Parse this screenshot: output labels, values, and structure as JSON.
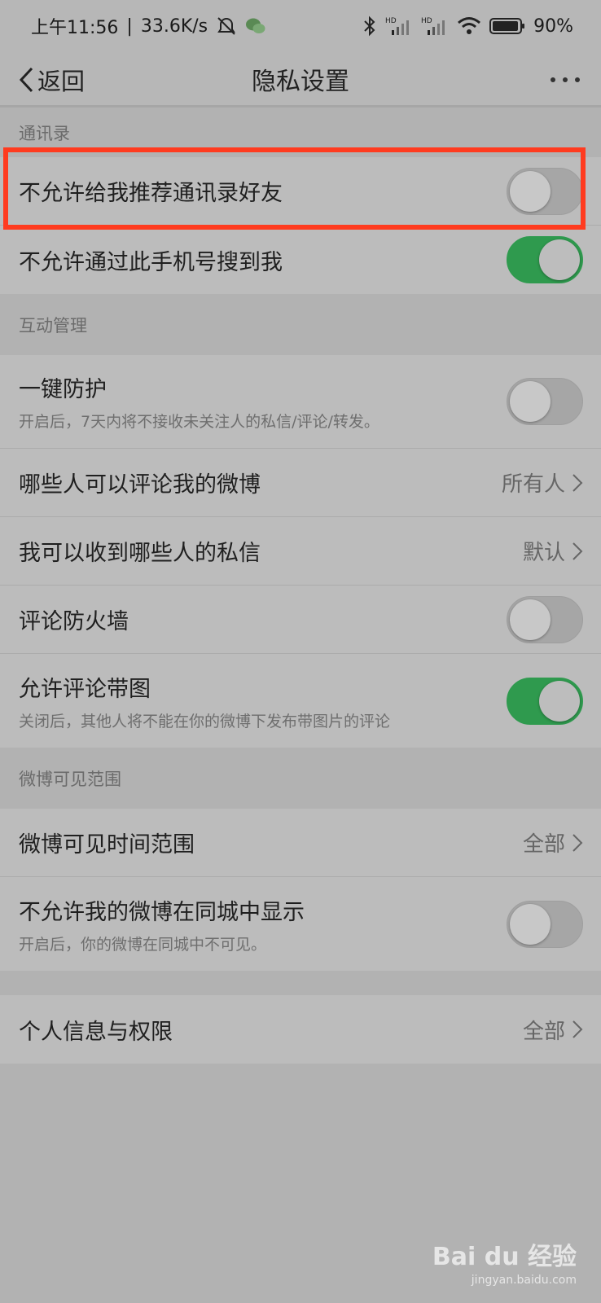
{
  "status_bar": {
    "time": "上午11:56",
    "speed": "33.6K/s",
    "battery": "90%",
    "icons": [
      "alarm-off-icon",
      "wechat-icon",
      "bluetooth-icon",
      "signal-hd-icon",
      "signal-hd-icon",
      "wifi-icon",
      "battery-icon"
    ]
  },
  "nav": {
    "back_label": "返回",
    "title": "隐私设置"
  },
  "sections": {
    "contacts": {
      "header": "通讯录",
      "rows": [
        {
          "label": "不允许给我推荐通讯录好友",
          "toggle": false
        },
        {
          "label": "不允许通过此手机号搜到我",
          "toggle": true
        }
      ]
    },
    "interaction": {
      "header": "互动管理",
      "rows": [
        {
          "label": "一键防护",
          "sub": "开启后，7天内将不接收未关注人的私信/评论/转发。",
          "toggle": false
        },
        {
          "label": "哪些人可以评论我的微博",
          "value": "所有人"
        },
        {
          "label": "我可以收到哪些人的私信",
          "value": "默认"
        },
        {
          "label": "评论防火墙",
          "toggle": false
        },
        {
          "label": "允许评论带图",
          "sub": "关闭后，其他人将不能在你的微博下发布带图片的评论",
          "toggle": true
        }
      ]
    },
    "visibility": {
      "header": "微博可见范围",
      "rows": [
        {
          "label": "微博可见时间范围",
          "value": "全部"
        },
        {
          "label": "不允许我的微博在同城中显示",
          "sub": "开启后，你的微博在同城中不可见。",
          "toggle": false
        }
      ]
    },
    "personal": {
      "rows": [
        {
          "label": "个人信息与权限",
          "value": "全部"
        }
      ]
    }
  },
  "colors": {
    "highlight": "#ff3b1f",
    "toggle_on": "#2f9a4e"
  },
  "watermark": {
    "brand": "Bai du 经验",
    "url": "jingyan.baidu.com"
  }
}
